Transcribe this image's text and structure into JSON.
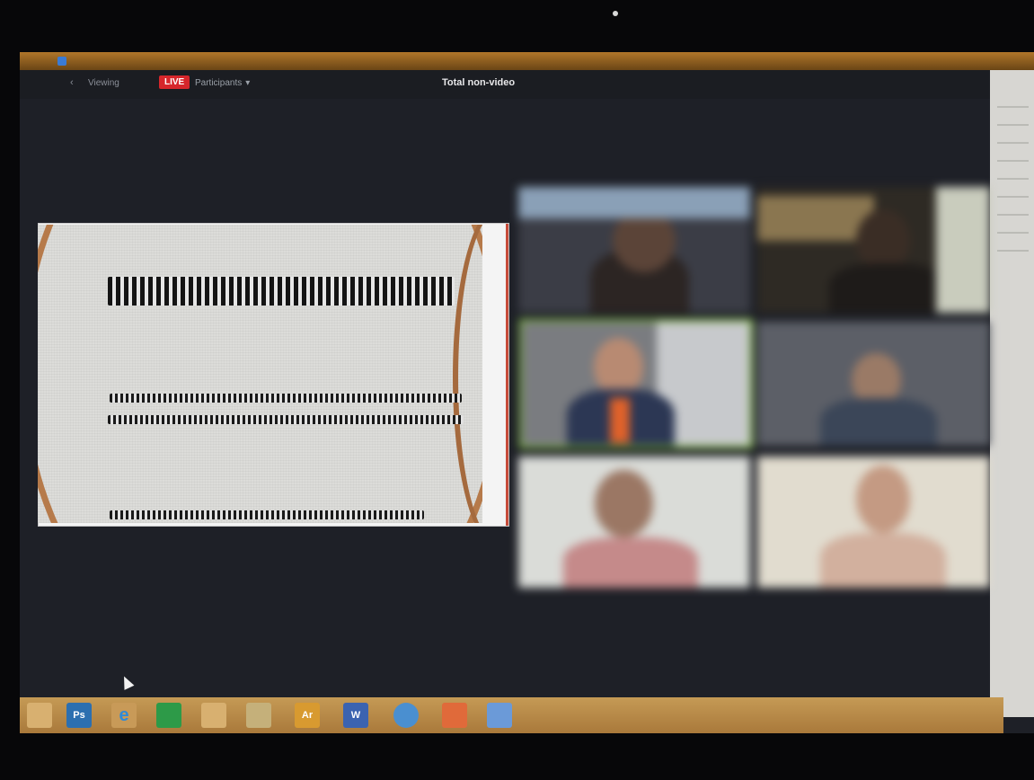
{
  "topbar": {
    "back_glyph": "‹",
    "viewing_label": "Viewing",
    "live_badge": "LIVE",
    "participants_label": "Participants",
    "caret": "▾",
    "total_text": "Total non-video"
  },
  "shared_screen": {
    "description_hidden": true
  },
  "gallery": {
    "participants": [
      {
        "name": "participant-1"
      },
      {
        "name": "participant-2"
      },
      {
        "name": "participant-3",
        "active": true
      },
      {
        "name": "participant-4"
      },
      {
        "name": "participant-5"
      },
      {
        "name": "participant-6"
      }
    ]
  },
  "taskbar": {
    "items": [
      {
        "icon": "folder-icon",
        "label": ""
      },
      {
        "icon": "photoshop-icon",
        "label": "Ps"
      },
      {
        "icon": "internet-explorer-icon",
        "label": "e"
      },
      {
        "icon": "store-icon",
        "label": ""
      },
      {
        "icon": "file-explorer-icon",
        "label": ""
      },
      {
        "icon": "app-icon",
        "label": ""
      },
      {
        "icon": "acrobat-icon",
        "label": "Ar"
      },
      {
        "icon": "word-icon",
        "label": "W"
      },
      {
        "icon": "chrome-icon",
        "label": ""
      },
      {
        "icon": "brave-icon",
        "label": ""
      },
      {
        "icon": "zoom-icon",
        "label": ""
      }
    ]
  },
  "colors": {
    "live_red": "#d6262b",
    "active_speaker": "#7fbf3a",
    "taskbar": "#b88a48"
  }
}
